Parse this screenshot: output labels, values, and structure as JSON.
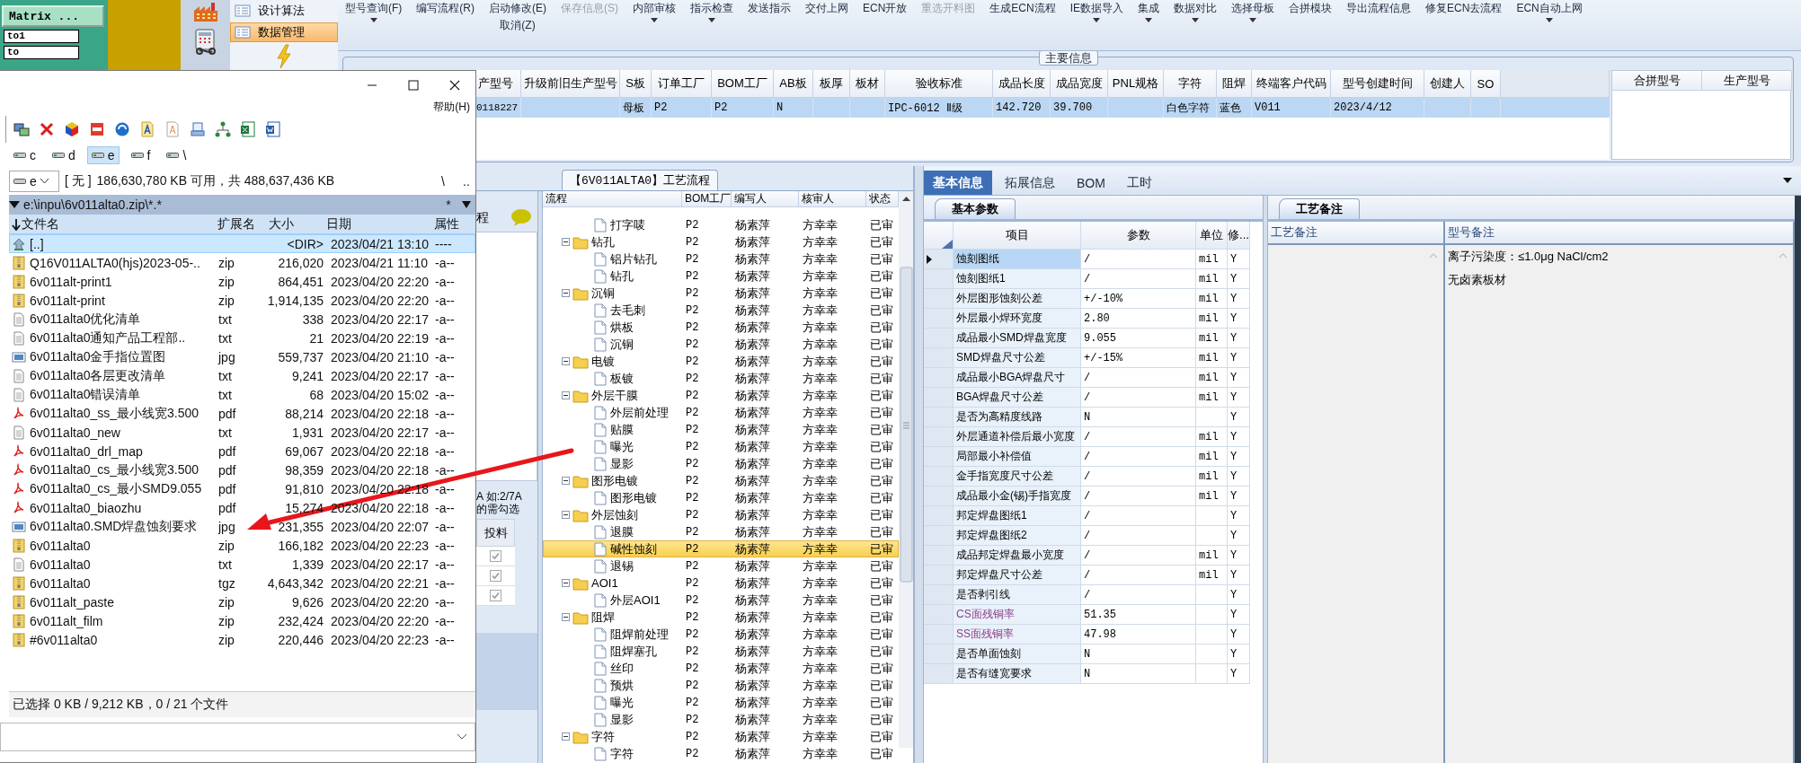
{
  "matrix_panel": {
    "button": "Matrix ...",
    "fields": [
      "to1",
      "to"
    ]
  },
  "nav_menu": [
    {
      "label": "设计算法",
      "selected": false
    },
    {
      "label": "数据管理",
      "selected": true
    }
  ],
  "ribbon": [
    {
      "label": "型号查询(F)",
      "dropdown": true,
      "disabled": false
    },
    {
      "label": "编写流程(R)",
      "dropdown": false,
      "disabled": false
    },
    {
      "label": "启动修改(E)",
      "sub_label": "取消(Z)",
      "dropdown": false,
      "disabled": false
    },
    {
      "label": "保存信息(S)",
      "dropdown": false,
      "disabled": true
    },
    {
      "label": "内部审核",
      "dropdown": true,
      "disabled": false
    },
    {
      "label": "指示检查",
      "dropdown": true,
      "disabled": false
    },
    {
      "label": "发送指示",
      "dropdown": false,
      "disabled": false
    },
    {
      "label": "交付上网",
      "dropdown": false,
      "disabled": false
    },
    {
      "label": "ECN开放",
      "dropdown": false,
      "disabled": false
    },
    {
      "label": "重选开料图",
      "dropdown": false,
      "disabled": true
    },
    {
      "label": "生成ECN流程",
      "dropdown": false,
      "disabled": false
    },
    {
      "label": "IE数据导入",
      "dropdown": true,
      "disabled": false
    },
    {
      "label": "集成",
      "dropdown": true,
      "disabled": false
    },
    {
      "label": "数据对比",
      "dropdown": true,
      "disabled": false
    },
    {
      "label": "选择母板",
      "dropdown": true,
      "disabled": false
    },
    {
      "label": "合拼模块",
      "dropdown": false,
      "disabled": false
    },
    {
      "label": "导出流程信息",
      "dropdown": false,
      "disabled": false
    },
    {
      "label": "修复ECN去流程",
      "dropdown": false,
      "disabled": false
    },
    {
      "label": "ECN自动上网",
      "dropdown": true,
      "disabled": false
    }
  ],
  "main_info": {
    "title": "主要信息",
    "columns": [
      "产型号",
      "升级前旧生产型号",
      "S板",
      "订单工厂",
      "BOM工厂",
      "AB板",
      "板厚",
      "板材",
      "验收标准",
      "成品长度",
      "成品宽度",
      "PNL规格",
      "字符",
      "阻焊",
      "终端客户代码",
      "型号创建时间",
      "创建人",
      "SO"
    ],
    "rows": [
      {
        "selected": true,
        "cells": [
          "0118227",
          "",
          "母板",
          "P2",
          "P2",
          "N",
          "",
          "",
          "IPC-6012 Ⅱ级",
          "142.720",
          "39.700",
          "",
          "白色字符",
          "蓝色",
          "V011",
          "2023/4/12",
          "",
          ""
        ]
      }
    ],
    "merge_columns": [
      "合拼型号",
      "生产型号"
    ]
  },
  "process_flow": {
    "title": "【6V011ALTA0】工艺流程",
    "side_header": "程",
    "side_notes": [
      "A 如:2/7A",
      "的需勾选"
    ],
    "feed_column": "投料",
    "feed_checks": [
      {
        "checked": true
      },
      {
        "checked": true
      },
      {
        "checked": true
      }
    ],
    "columns": [
      "流程",
      "BOM工厂",
      "编写人",
      "核审人",
      "状态"
    ],
    "tree": [
      {
        "children": [
          {
            "label": "打字唛",
            "bom": "P2",
            "writer": "杨素萍",
            "reviewer": "方幸幸",
            "status": "已审",
            "selected": false
          }
        ]
      },
      {
        "label": "钻孔",
        "bom": "P2",
        "writer": "杨素萍",
        "reviewer": "方幸幸",
        "status": "已审",
        "selected": false,
        "expanded": true,
        "children": [
          {
            "label": "铝片钻孔",
            "bom": "P2",
            "writer": "杨素萍",
            "reviewer": "方幸幸",
            "status": "已审",
            "selected": false
          },
          {
            "label": "钻孔",
            "bom": "P2",
            "writer": "杨素萍",
            "reviewer": "方幸幸",
            "status": "已审",
            "selected": false
          }
        ]
      },
      {
        "label": "沉铜",
        "bom": "P2",
        "writer": "杨素萍",
        "reviewer": "方幸幸",
        "status": "已审",
        "selected": false,
        "expanded": true,
        "children": [
          {
            "label": "去毛刺",
            "bom": "P2",
            "writer": "杨素萍",
            "reviewer": "方幸幸",
            "status": "已审",
            "selected": false
          },
          {
            "label": "烘板",
            "bom": "P2",
            "writer": "杨素萍",
            "reviewer": "方幸幸",
            "status": "已审",
            "selected": false
          },
          {
            "label": "沉铜",
            "bom": "P2",
            "writer": "杨素萍",
            "reviewer": "方幸幸",
            "status": "已审",
            "selected": false
          }
        ]
      },
      {
        "label": "电镀",
        "bom": "P2",
        "writer": "杨素萍",
        "reviewer": "方幸幸",
        "status": "已审",
        "selected": false,
        "expanded": true,
        "children": [
          {
            "label": "板镀",
            "bom": "P2",
            "writer": "杨素萍",
            "reviewer": "方幸幸",
            "status": "已审",
            "selected": false
          }
        ]
      },
      {
        "label": "外层干膜",
        "bom": "P2",
        "writer": "杨素萍",
        "reviewer": "方幸幸",
        "status": "已审",
        "selected": false,
        "expanded": true,
        "children": [
          {
            "label": "外层前处理",
            "bom": "P2",
            "writer": "杨素萍",
            "reviewer": "方幸幸",
            "status": "已审",
            "selected": false
          },
          {
            "label": "贴膜",
            "bom": "P2",
            "writer": "杨素萍",
            "reviewer": "方幸幸",
            "status": "已审",
            "selected": false
          },
          {
            "label": "曝光",
            "bom": "P2",
            "writer": "杨素萍",
            "reviewer": "方幸幸",
            "status": "已审",
            "selected": false
          },
          {
            "label": "显影",
            "bom": "P2",
            "writer": "杨素萍",
            "reviewer": "方幸幸",
            "status": "已审",
            "selected": false
          }
        ]
      },
      {
        "label": "图形电镀",
        "bom": "P2",
        "writer": "杨素萍",
        "reviewer": "方幸幸",
        "status": "已审",
        "selected": false,
        "expanded": true,
        "children": [
          {
            "label": "图形电镀",
            "bom": "P2",
            "writer": "杨素萍",
            "reviewer": "方幸幸",
            "status": "已审",
            "selected": false
          }
        ]
      },
      {
        "label": "外层蚀刻",
        "bom": "P2",
        "writer": "杨素萍",
        "reviewer": "方幸幸",
        "status": "已审",
        "selected": false,
        "expanded": true,
        "children": [
          {
            "label": "退膜",
            "bom": "P2",
            "writer": "杨素萍",
            "reviewer": "方幸幸",
            "status": "已审",
            "selected": false
          },
          {
            "label": "碱性蚀刻",
            "bom": "P2",
            "writer": "杨素萍",
            "reviewer": "方幸幸",
            "status": "已审",
            "selected": true
          },
          {
            "label": "退锡",
            "bom": "P2",
            "writer": "杨素萍",
            "reviewer": "方幸幸",
            "status": "已审",
            "selected": false
          }
        ]
      },
      {
        "label": "AOI1",
        "bom": "P2",
        "writer": "杨素萍",
        "reviewer": "方幸幸",
        "status": "已审",
        "selected": false,
        "expanded": true,
        "children": [
          {
            "label": "外层AOI1",
            "bom": "P2",
            "writer": "杨素萍",
            "reviewer": "方幸幸",
            "status": "已审",
            "selected": false
          }
        ]
      },
      {
        "label": "阻焊",
        "bom": "P2",
        "writer": "杨素萍",
        "reviewer": "方幸幸",
        "status": "已审",
        "selected": false,
        "expanded": true,
        "children": [
          {
            "label": "阻焊前处理",
            "bom": "P2",
            "writer": "杨素萍",
            "reviewer": "方幸幸",
            "status": "已审",
            "selected": false
          },
          {
            "label": "阻焊塞孔",
            "bom": "P2",
            "writer": "杨素萍",
            "reviewer": "方幸幸",
            "status": "已审",
            "selected": false
          },
          {
            "label": "丝印",
            "bom": "P2",
            "writer": "杨素萍",
            "reviewer": "方幸幸",
            "status": "已审",
            "selected": false
          },
          {
            "label": "预烘",
            "bom": "P2",
            "writer": "杨素萍",
            "reviewer": "方幸幸",
            "status": "已审",
            "selected": false
          },
          {
            "label": "曝光",
            "bom": "P2",
            "writer": "杨素萍",
            "reviewer": "方幸幸",
            "status": "已审",
            "selected": false
          },
          {
            "label": "显影",
            "bom": "P2",
            "writer": "杨素萍",
            "reviewer": "方幸幸",
            "status": "已审",
            "selected": false
          }
        ]
      },
      {
        "label": "字符",
        "bom": "P2",
        "writer": "杨素萍",
        "reviewer": "方幸幸",
        "status": "已审",
        "selected": false,
        "expanded": true,
        "children": [
          {
            "label": "字符",
            "bom": "P2",
            "writer": "杨素萍",
            "reviewer": "方幸幸",
            "status": "已审",
            "selected": false
          }
        ]
      }
    ]
  },
  "details": {
    "tabs": [
      {
        "label": "基本信息",
        "selected": true
      },
      {
        "label": "拓展信息",
        "selected": false
      },
      {
        "label": "BOM",
        "selected": false
      },
      {
        "label": "工时",
        "selected": false
      }
    ],
    "params": {
      "tab": "基本参数",
      "columns": [
        "项目",
        "参数",
        "单位",
        "修..."
      ],
      "rows": [
        {
          "name": "蚀刻图纸",
          "value": "/",
          "unit": "mil",
          "flag": "Y",
          "selected": true,
          "emphasized": false
        },
        {
          "name": "蚀刻图纸1",
          "value": "/",
          "unit": "mil",
          "flag": "Y",
          "selected": false,
          "emphasized": false
        },
        {
          "name": "外层图形蚀刻公差",
          "value": "+/-10%",
          "unit": "mil",
          "flag": "Y",
          "selected": false,
          "emphasized": false
        },
        {
          "name": "外层最小焊环宽度",
          "value": "2.80",
          "unit": "mil",
          "flag": "Y",
          "selected": false,
          "emphasized": false
        },
        {
          "name": "成品最小SMD焊盘宽度",
          "value": "9.055",
          "unit": "mil",
          "flag": "Y",
          "selected": false,
          "emphasized": false
        },
        {
          "name": "SMD焊盘尺寸公差",
          "value": "+/-15%",
          "unit": "mil",
          "flag": "Y",
          "selected": false,
          "emphasized": false
        },
        {
          "name": "成品最小BGA焊盘尺寸",
          "value": "/",
          "unit": "mil",
          "flag": "Y",
          "selected": false,
          "emphasized": false
        },
        {
          "name": "BGA焊盘尺寸公差",
          "value": "/",
          "unit": "mil",
          "flag": "Y",
          "selected": false,
          "emphasized": false
        },
        {
          "name": "是否为高精度线路",
          "value": "N",
          "flag": "Y",
          "selected": false,
          "emphasized": false
        },
        {
          "name": "外层通道补偿后最小宽度",
          "value": "/",
          "unit": "mil",
          "flag": "Y",
          "selected": false,
          "emphasized": false
        },
        {
          "name": "局部最小补偿值",
          "value": "/",
          "unit": "mil",
          "flag": "Y",
          "selected": false,
          "emphasized": false
        },
        {
          "name": "金手指宽度尺寸公差",
          "value": "/",
          "unit": "mil",
          "flag": "Y",
          "selected": false,
          "emphasized": false
        },
        {
          "name": "成品最小金(锡)手指宽度",
          "value": "/",
          "unit": "mil",
          "flag": "Y",
          "selected": false,
          "emphasized": false
        },
        {
          "name": "邦定焊盘图纸1",
          "value": "/",
          "flag": "Y",
          "selected": false,
          "emphasized": false
        },
        {
          "name": "邦定焊盘图纸2",
          "value": "/",
          "flag": "Y",
          "selected": false,
          "emphasized": false
        },
        {
          "name": "成品邦定焊盘最小宽度",
          "value": "/",
          "unit": "mil",
          "flag": "Y",
          "selected": false,
          "emphasized": false
        },
        {
          "name": "邦定焊盘尺寸公差",
          "value": "/",
          "unit": "mil",
          "flag": "Y",
          "selected": false,
          "emphasized": false
        },
        {
          "name": "是否剥引线",
          "value": "/",
          "flag": "Y",
          "selected": false,
          "emphasized": false
        },
        {
          "name": "CS面残铜率",
          "value": "51.35",
          "flag": "Y",
          "selected": false,
          "emphasized": true
        },
        {
          "name": "SS面残铜率",
          "value": "47.98",
          "flag": "Y",
          "selected": false,
          "emphasized": true
        },
        {
          "name": "是否单面蚀刻",
          "value": "N",
          "flag": "Y",
          "selected": false,
          "emphasized": false
        },
        {
          "name": "是否有缝宽要求",
          "value": "N",
          "flag": "Y",
          "selected": false,
          "emphasized": false
        }
      ]
    },
    "remarks": {
      "tab": "工艺备注",
      "columns": [
        "工艺备注",
        "型号备注"
      ],
      "model_notes": [
        "离子污染度：≤1.0μg NaCl/cm2",
        "无卤素板材"
      ]
    }
  },
  "file_window": {
    "menu": [
      "帮助(H)"
    ],
    "drives": [
      {
        "label": "c",
        "selected": false
      },
      {
        "label": "d",
        "selected": false
      },
      {
        "label": "e",
        "selected": true
      },
      {
        "label": "f",
        "selected": false
      },
      {
        "label": "\\",
        "selected": false
      }
    ],
    "drive_combo": "e",
    "volume_label": "[ 无 ]",
    "free_space": "186,630,780 KB 可用，共 488,637,436 KB",
    "nav": [
      "\\",
      ".."
    ],
    "path": "e:\\inpu\\6v011alta0.zip\\*.*",
    "filter": "*",
    "columns": [
      "文件名",
      "扩展名",
      "大小",
      "日期",
      "属性"
    ],
    "files": [
      {
        "name": "[..]",
        "size": "<DIR>",
        "date": "2023/04/21 13:10",
        "attr": "----",
        "kind": "up",
        "selected": true
      },
      {
        "name": "Q16V011ALTA0(hjs)2023-05-..",
        "ext": "zip",
        "size": "216,020",
        "date": "2023/04/21 11:10",
        "attr": "-a--",
        "kind": "archive",
        "selected": false
      },
      {
        "name": "6v011alt-print1",
        "ext": "zip",
        "size": "864,451",
        "date": "2023/04/20 22:20",
        "attr": "-a--",
        "kind": "archive",
        "selected": false
      },
      {
        "name": "6v011alt-print",
        "ext": "zip",
        "size": "1,914,135",
        "date": "2023/04/20 22:20",
        "attr": "-a--",
        "kind": "archive",
        "selected": false
      },
      {
        "name": "6v011alta0优化清单",
        "ext": "txt",
        "size": "338",
        "date": "2023/04/20 22:17",
        "attr": "-a--",
        "kind": "text",
        "selected": false
      },
      {
        "name": "6v011alta0通知产品工程部..",
        "ext": "txt",
        "size": "21",
        "date": "2023/04/20 22:19",
        "attr": "-a--",
        "kind": "text",
        "selected": false
      },
      {
        "name": "6v011alta0金手指位置图",
        "ext": "jpg",
        "size": "559,737",
        "date": "2023/04/20 21:10",
        "attr": "-a--",
        "kind": "image",
        "selected": false
      },
      {
        "name": "6v011alta0各层更改清单",
        "ext": "txt",
        "size": "9,241",
        "date": "2023/04/20 22:17",
        "attr": "-a--",
        "kind": "text",
        "selected": false
      },
      {
        "name": "6v011alta0错误清单",
        "ext": "txt",
        "size": "68",
        "date": "2023/04/20 15:02",
        "attr": "-a--",
        "kind": "text",
        "selected": false
      },
      {
        "name": "6v011alta0_ss_最小线宽3.500",
        "ext": "pdf",
        "size": "88,214",
        "date": "2023/04/20 22:18",
        "attr": "-a--",
        "kind": "pdf",
        "selected": false
      },
      {
        "name": "6v011alta0_new",
        "ext": "txt",
        "size": "1,931",
        "date": "2023/04/20 22:17",
        "attr": "-a--",
        "kind": "text",
        "selected": false
      },
      {
        "name": "6v011alta0_drl_map",
        "ext": "pdf",
        "size": "69,067",
        "date": "2023/04/20 22:18",
        "attr": "-a--",
        "kind": "pdf",
        "selected": false
      },
      {
        "name": "6v011alta0_cs_最小线宽3.500",
        "ext": "pdf",
        "size": "98,359",
        "date": "2023/04/20 22:18",
        "attr": "-a--",
        "kind": "pdf",
        "selected": false
      },
      {
        "name": "6v011alta0_cs_最小SMD9.055",
        "ext": "pdf",
        "size": "91,810",
        "date": "2023/04/20 22:18",
        "attr": "-a--",
        "kind": "pdf",
        "selected": false
      },
      {
        "name": "6v011alta0_biaozhu",
        "ext": "pdf",
        "size": "15,274",
        "date": "2023/04/20 22:18",
        "attr": "-a--",
        "kind": "pdf",
        "selected": false
      },
      {
        "name": "6v011alta0.SMD焊盘蚀刻要求",
        "ext": "jpg",
        "size": "231,355",
        "date": "2023/04/20 22:07",
        "attr": "-a--",
        "kind": "image",
        "selected": false
      },
      {
        "name": "6v011alta0",
        "ext": "zip",
        "size": "166,182",
        "date": "2023/04/20 22:23",
        "attr": "-a--",
        "kind": "archive",
        "selected": false
      },
      {
        "name": "6v011alta0",
        "ext": "txt",
        "size": "1,339",
        "date": "2023/04/20 22:17",
        "attr": "-a--",
        "kind": "text",
        "selected": false
      },
      {
        "name": "6v011alta0",
        "ext": "tgz",
        "size": "4,643,342",
        "date": "2023/04/20 22:21",
        "attr": "-a--",
        "kind": "archive",
        "selected": false
      },
      {
        "name": "6v011alt_paste",
        "ext": "zip",
        "size": "9,626",
        "date": "2023/04/20 22:20",
        "attr": "-a--",
        "kind": "archive",
        "selected": false
      },
      {
        "name": "6v011alt_film",
        "ext": "zip",
        "size": "232,424",
        "date": "2023/04/20 22:20",
        "attr": "-a--",
        "kind": "archive",
        "selected": false
      },
      {
        "name": "#6v011alta0",
        "ext": "zip",
        "size": "220,446",
        "date": "2023/04/20 22:23",
        "attr": "-a--",
        "kind": "archive",
        "selected": false
      }
    ],
    "status": "已选择 0 KB / 9,212 KB，0 / 21 个文件"
  }
}
